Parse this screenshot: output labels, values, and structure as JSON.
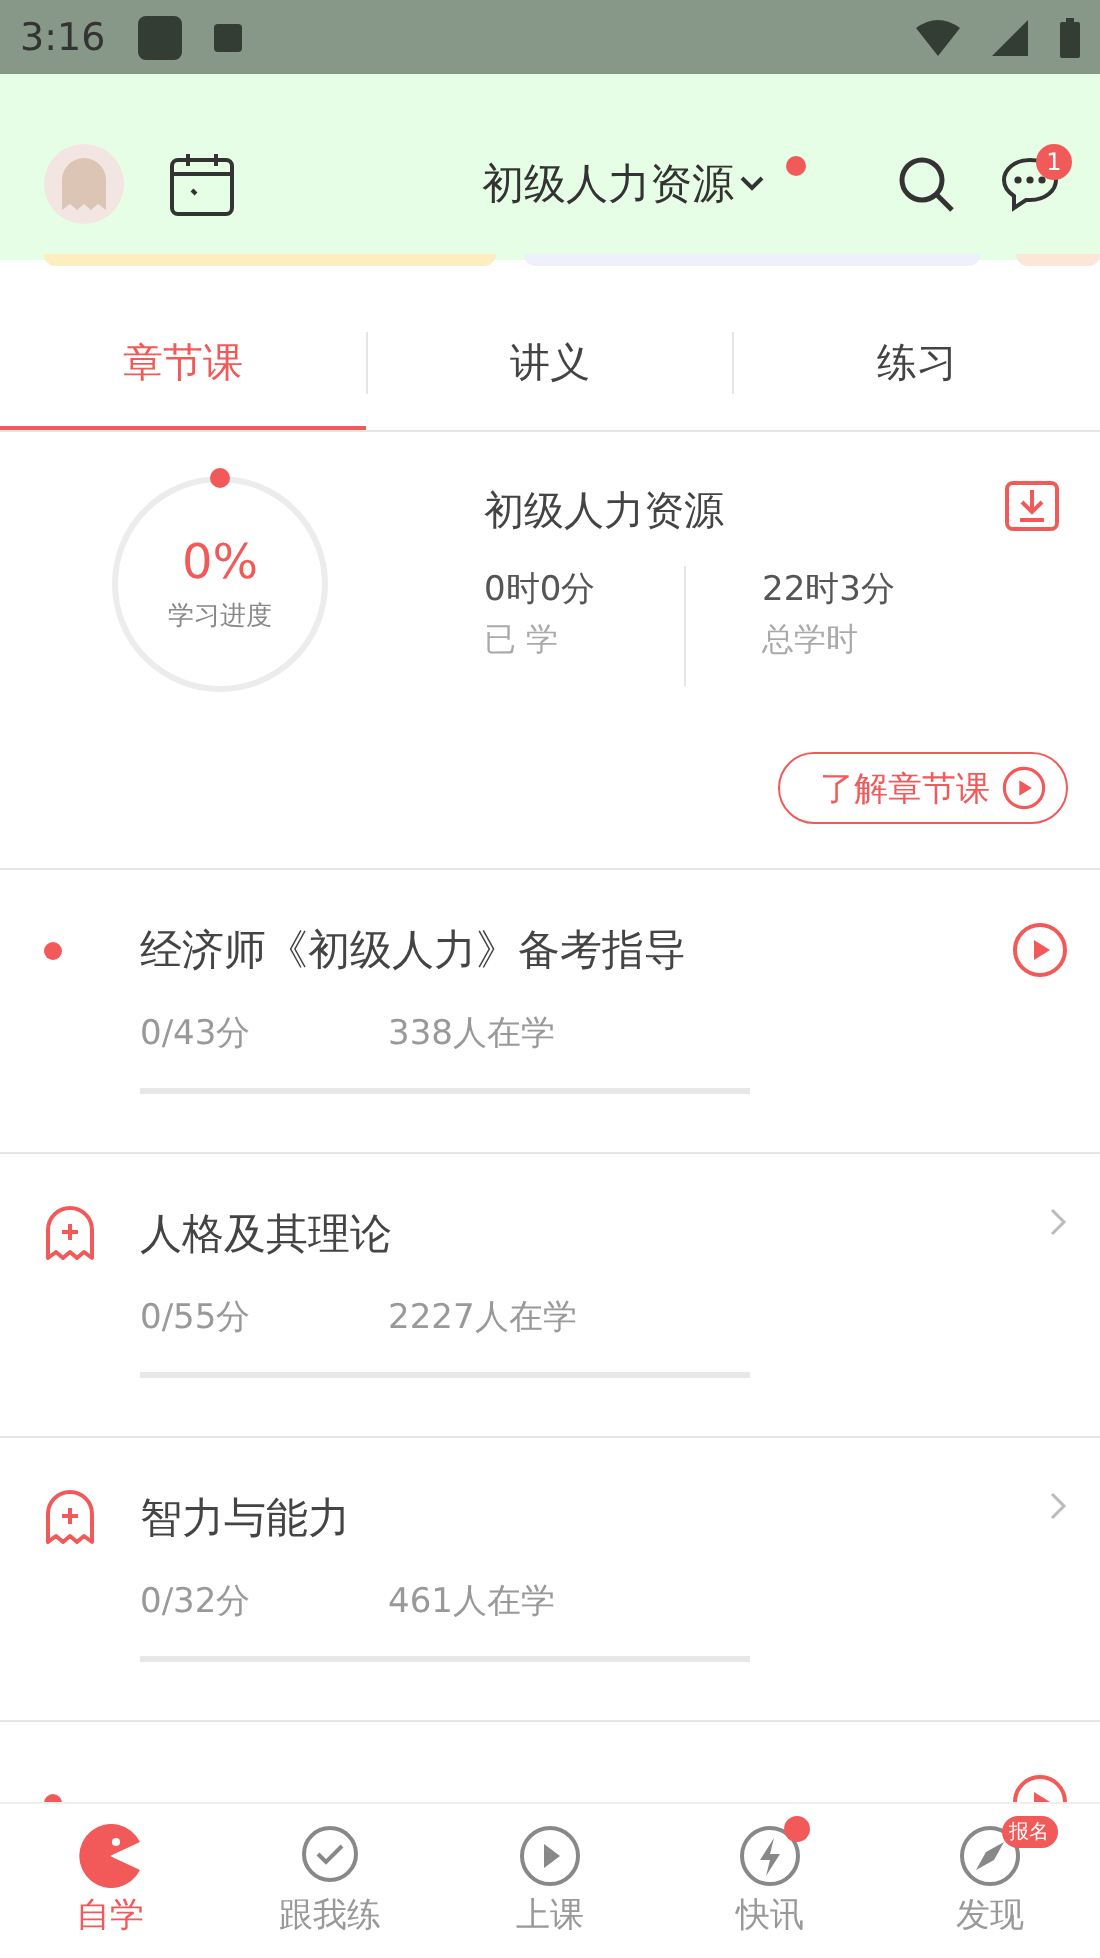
{
  "status_bar": {
    "time": "3:16"
  },
  "header": {
    "title": "初级人力资源",
    "title_dot": true,
    "message_badge": "1"
  },
  "tabs": [
    {
      "label": "章节课",
      "selected": true
    },
    {
      "label": "讲义",
      "selected": false
    },
    {
      "label": "练习",
      "selected": false
    }
  ],
  "summary": {
    "percent": "0%",
    "progress_label": "学习进度",
    "course": "初级人力资源",
    "studied": "0时0分",
    "studied_label": "已 学",
    "total": "22时3分",
    "total_label": "总学时",
    "intro_button": "了解章节课"
  },
  "chapters": [
    {
      "kind": "video",
      "title": "经济师《初级人力》备考指导",
      "score": "0/43分",
      "learners": "338人在学"
    },
    {
      "kind": "chapter",
      "title": "人格及其理论",
      "score": "0/55分",
      "learners": "2227人在学"
    },
    {
      "kind": "chapter",
      "title": "智力与能力",
      "score": "0/32分",
      "learners": "461人在学"
    },
    {
      "kind": "video"
    }
  ],
  "bottom_nav": [
    {
      "label": "自学",
      "selected": true
    },
    {
      "label": "跟我练",
      "selected": false
    },
    {
      "label": "上课",
      "selected": false,
      "dot": false
    },
    {
      "label": "快讯",
      "selected": false,
      "dot": true
    },
    {
      "label": "发现",
      "selected": false,
      "badge": "报名"
    }
  ]
}
